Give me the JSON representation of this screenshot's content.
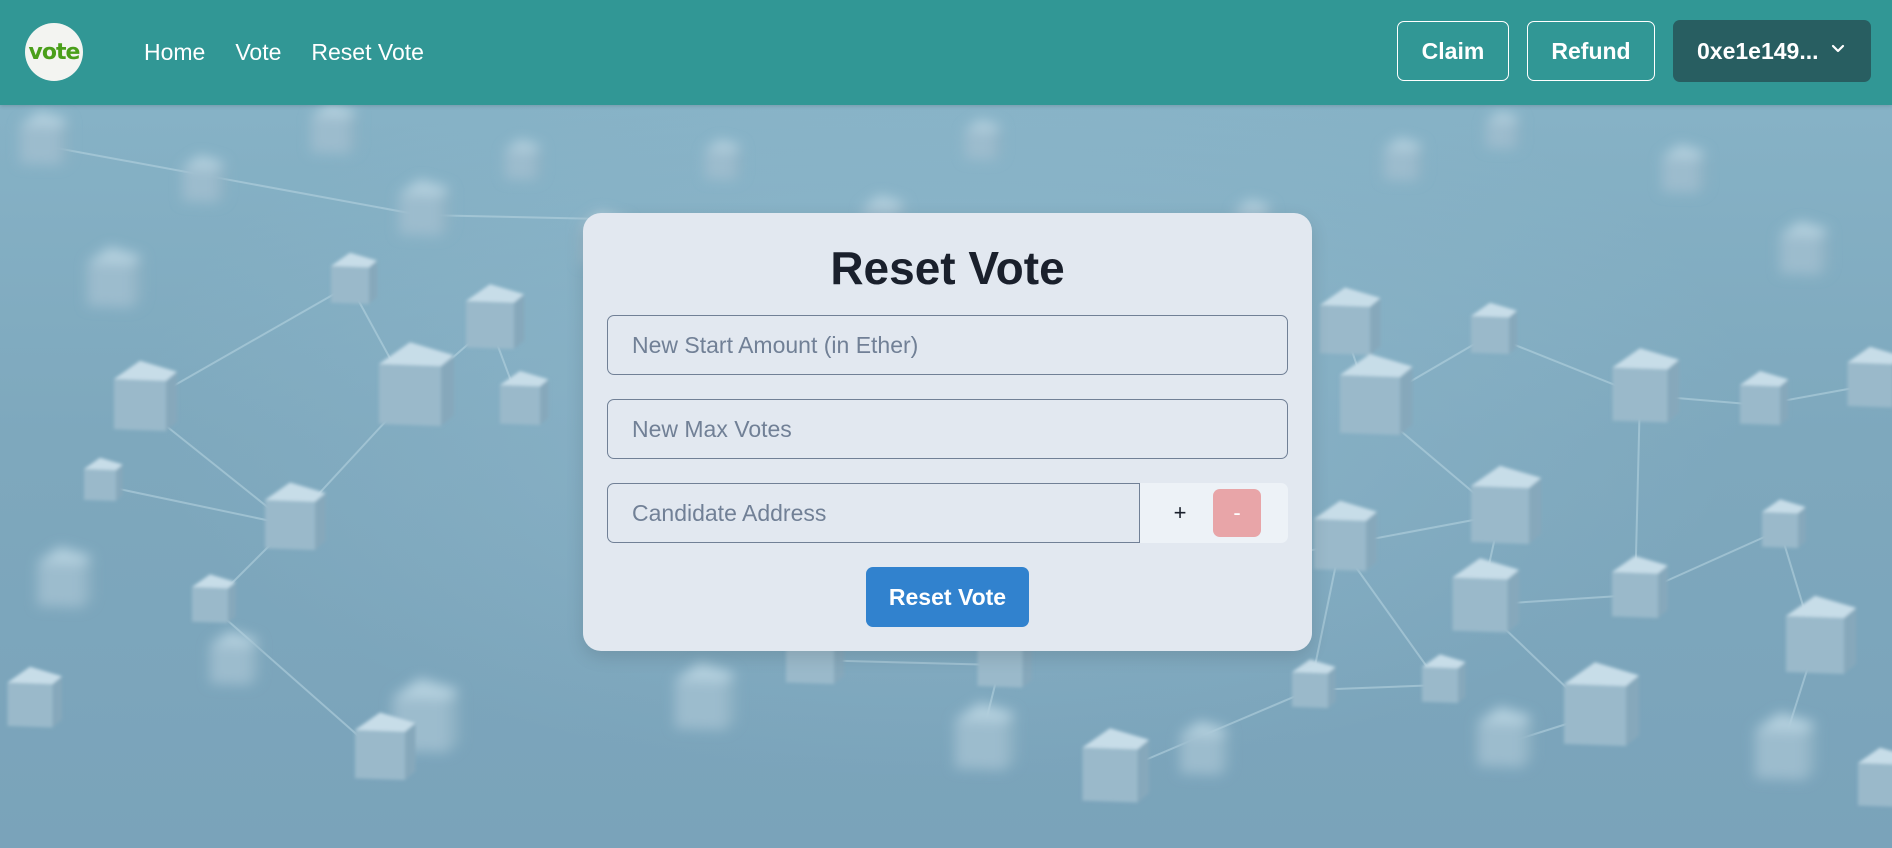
{
  "header": {
    "logo_text": "vote",
    "nav": {
      "home": "Home",
      "vote": "Vote",
      "reset_vote": "Reset Vote"
    },
    "claim_label": "Claim",
    "refund_label": "Refund",
    "account_label": "0xe1e149..."
  },
  "form": {
    "title": "Reset Vote",
    "start_amount_placeholder": "New Start Amount (in Ether)",
    "max_votes_placeholder": "New Max Votes",
    "candidate_placeholder": "Candidate Address",
    "add_label": "+",
    "remove_label": "-",
    "submit_label": "Reset Vote"
  },
  "colors": {
    "header": "#319795",
    "account_button": "#285e61",
    "card": "#e2e8f0",
    "primary": "#3182ce",
    "remove_button": "#e8a5a8"
  },
  "icons": {
    "account_dropdown": "chevron-down-icon",
    "background": "blockchain-network-image"
  }
}
